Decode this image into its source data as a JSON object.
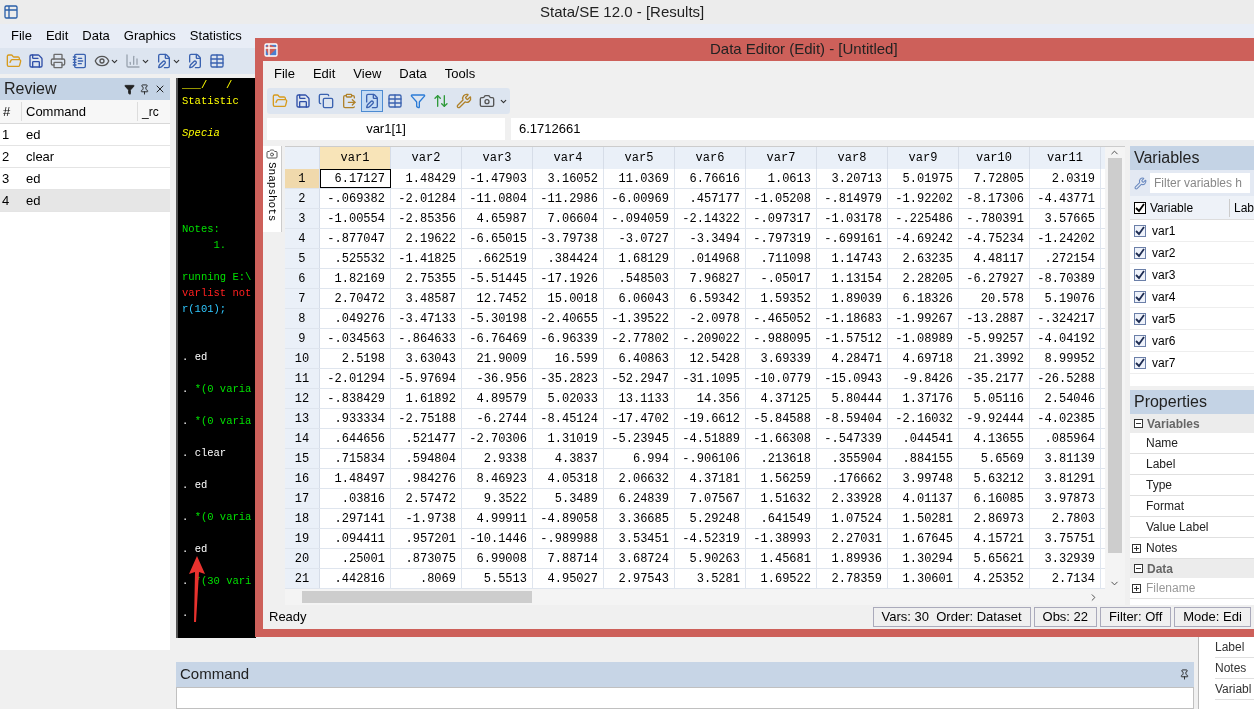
{
  "window": {
    "title": "Stata/SE 12.0 - [Results]"
  },
  "menu": [
    "File",
    "Edit",
    "Data",
    "Graphics",
    "Statistics"
  ],
  "toolbar": [
    {
      "kind": "open"
    },
    {
      "kind": "save"
    },
    {
      "kind": "print"
    },
    {
      "kind": "log"
    },
    {
      "kind": "viewer"
    },
    {
      "kind": "graph"
    },
    {
      "kind": "dofile"
    },
    {
      "kind": "edit"
    },
    {
      "kind": "browse"
    }
  ],
  "review": {
    "title": "Review",
    "columns": [
      "#",
      "Command",
      "_rc"
    ],
    "rows": [
      {
        "num": "1",
        "command": "ed",
        "selected": false
      },
      {
        "num": "2",
        "command": "clear",
        "selected": false
      },
      {
        "num": "3",
        "command": "ed",
        "selected": false
      },
      {
        "num": "4",
        "command": "ed",
        "selected": true
      }
    ]
  },
  "results": [
    {
      "kind": "banner",
      "text": "___/   /"
    },
    {
      "kind": "banner",
      "text": "Statistic"
    },
    {
      "kind": "blank"
    },
    {
      "kind": "banner_italic",
      "text": "Specia"
    },
    {
      "kind": "blank"
    },
    {
      "kind": "blank"
    },
    {
      "kind": "blank"
    },
    {
      "kind": "blank"
    },
    {
      "kind": "blank"
    },
    {
      "kind": "output",
      "text": "Notes:"
    },
    {
      "kind": "output",
      "text": "     1."
    },
    {
      "kind": "blank"
    },
    {
      "kind": "output",
      "text": "running E:\\"
    },
    {
      "kind": "error",
      "text": "varlist not"
    },
    {
      "kind": "rc",
      "text": "r(101);"
    },
    {
      "kind": "blank"
    },
    {
      "kind": "blank"
    },
    {
      "kind": "command",
      "prompt": ".",
      "text": "ed"
    },
    {
      "kind": "blank"
    },
    {
      "kind": "echo",
      "prompt": ".",
      "text": "*(0 varia"
    },
    {
      "kind": "blank"
    },
    {
      "kind": "echo",
      "prompt": ".",
      "text": "*(0 varia"
    },
    {
      "kind": "blank"
    },
    {
      "kind": "command",
      "prompt": ".",
      "text": "clear"
    },
    {
      "kind": "blank"
    },
    {
      "kind": "command",
      "prompt": ".",
      "text": "ed"
    },
    {
      "kind": "blank"
    },
    {
      "kind": "echo",
      "prompt": ".",
      "text": "*(0 varia"
    },
    {
      "kind": "blank"
    },
    {
      "kind": "command",
      "prompt": ".",
      "text": "ed"
    },
    {
      "kind": "blank"
    },
    {
      "kind": "echo",
      "prompt": ".",
      "text": "*(30 vari"
    },
    {
      "kind": "blank"
    },
    {
      "kind": "command",
      "prompt": "."
    }
  ],
  "command_panel": {
    "title": "Command"
  },
  "background_properties": [
    "Label",
    "Notes",
    "Variabl"
  ],
  "data_editor": {
    "title": "Data Editor (Edit) - [Untitled]",
    "menu": [
      "File",
      "Edit",
      "View",
      "Data",
      "Tools"
    ],
    "toolbar": [
      {
        "kind": "open",
        "selected": false
      },
      {
        "kind": "save",
        "selected": false
      },
      {
        "kind": "copy",
        "selected": false
      },
      {
        "kind": "paste",
        "selected": false
      },
      {
        "kind": "edit",
        "selected": true
      },
      {
        "kind": "browse",
        "selected": false
      },
      {
        "kind": "filter",
        "selected": false
      },
      {
        "kind": "varmanager",
        "selected": false
      },
      {
        "kind": "properties",
        "selected": false
      },
      {
        "kind": "snapshot",
        "selected": false
      }
    ],
    "cell_ref": "var1[1]",
    "cell_value": "6.1712661",
    "snapshots_tab": "Snapshots",
    "columns": [
      {
        "name": "var1",
        "selected": true
      },
      {
        "name": "var2",
        "selected": false
      },
      {
        "name": "var3",
        "selected": false
      },
      {
        "name": "var4",
        "selected": false
      },
      {
        "name": "var5",
        "selected": false
      },
      {
        "name": "var6",
        "selected": false
      },
      {
        "name": "var7",
        "selected": false
      },
      {
        "name": "var8",
        "selected": false
      },
      {
        "name": "var9",
        "selected": false
      },
      {
        "name": "var10",
        "selected": false
      },
      {
        "name": "var11",
        "selected": false
      }
    ],
    "rows": [
      {
        "label": "1",
        "selected": true,
        "cells": [
          "6.17127",
          "1.48429",
          "-1.47903",
          "3.16052",
          "11.0369",
          "6.76616",
          "1.0613",
          "3.20713",
          "5.01975",
          "7.72805",
          "2.0319"
        ]
      },
      {
        "label": "2",
        "selected": false,
        "cells": [
          "-.069382",
          "-2.01284",
          "-11.0804",
          "-11.2986",
          "-6.00969",
          ".457177",
          "-1.05208",
          "-.814979",
          "-1.92202",
          "-8.17306",
          "-4.43771"
        ]
      },
      {
        "label": "3",
        "selected": false,
        "cells": [
          "-1.00554",
          "-2.85356",
          "4.65987",
          "7.06604",
          "-.094059",
          "-2.14322",
          "-.097317",
          "-1.03178",
          "-.225486",
          "-.780391",
          "3.57665"
        ]
      },
      {
        "label": "4",
        "selected": false,
        "cells": [
          "-.877047",
          "2.19622",
          "-6.65015",
          "-3.79738",
          "-3.0727",
          "-3.3494",
          "-.797319",
          "-.699161",
          "-4.69242",
          "-4.75234",
          "-1.24202"
        ]
      },
      {
        "label": "5",
        "selected": false,
        "cells": [
          ".525532",
          "-1.41825",
          ".662519",
          ".384424",
          "1.68129",
          ".014968",
          ".711098",
          "1.14743",
          "2.63235",
          "4.48117",
          ".272154"
        ]
      },
      {
        "label": "6",
        "selected": false,
        "cells": [
          "1.82169",
          "2.75355",
          "-5.51445",
          "-17.1926",
          ".548503",
          "7.96827",
          "-.05017",
          "1.13154",
          "2.28205",
          "-6.27927",
          "-8.70389"
        ]
      },
      {
        "label": "7",
        "selected": false,
        "cells": [
          "2.70472",
          "3.48587",
          "12.7452",
          "15.0018",
          "6.06043",
          "6.59342",
          "1.59352",
          "1.89039",
          "6.18326",
          "20.578",
          "5.19076"
        ]
      },
      {
        "label": "8",
        "selected": false,
        "cells": [
          ".049276",
          "-3.47133",
          "-5.30198",
          "-2.40655",
          "-1.39522",
          "-2.0978",
          "-.465052",
          "-1.18683",
          "-1.99267",
          "-13.2887",
          "-.324217"
        ]
      },
      {
        "label": "9",
        "selected": false,
        "cells": [
          "-.034563",
          "-.864633",
          "-6.76469",
          "-6.96339",
          "-2.77802",
          "-.209022",
          "-.988095",
          "-1.57512",
          "-1.08989",
          "-5.99257",
          "-4.04192"
        ]
      },
      {
        "label": "10",
        "selected": false,
        "cells": [
          "2.5198",
          "3.63043",
          "21.9009",
          "16.599",
          "6.40863",
          "12.5428",
          "3.69339",
          "4.28471",
          "4.69718",
          "21.3992",
          "8.99952"
        ]
      },
      {
        "label": "11",
        "selected": false,
        "cells": [
          "-2.01294",
          "-5.97694",
          "-36.956",
          "-35.2823",
          "-52.2947",
          "-31.1095",
          "-10.0779",
          "-15.0943",
          "-9.8426",
          "-35.2177",
          "-26.5288"
        ]
      },
      {
        "label": "12",
        "selected": false,
        "cells": [
          "-.838429",
          "1.61892",
          "4.89579",
          "5.02033",
          "13.1133",
          "14.356",
          "4.37125",
          "5.80444",
          "1.37176",
          "5.05116",
          "2.54046"
        ]
      },
      {
        "label": "13",
        "selected": false,
        "cells": [
          ".933334",
          "-2.75188",
          "-6.2744",
          "-8.45124",
          "-17.4702",
          "-19.6612",
          "-5.84588",
          "-8.59404",
          "-2.16032",
          "-9.92444",
          "-4.02385"
        ]
      },
      {
        "label": "14",
        "selected": false,
        "cells": [
          ".644656",
          ".521477",
          "-2.70306",
          "1.31019",
          "-5.23945",
          "-4.51889",
          "-1.66308",
          "-.547339",
          ".044541",
          "4.13655",
          ".085964"
        ]
      },
      {
        "label": "15",
        "selected": false,
        "cells": [
          ".715834",
          ".594804",
          "2.9338",
          "4.3837",
          "6.994",
          "-.906106",
          ".213618",
          ".355904",
          ".884155",
          "5.6569",
          "3.81139"
        ]
      },
      {
        "label": "16",
        "selected": false,
        "cells": [
          "1.48497",
          ".984276",
          "8.46923",
          "4.05318",
          "2.06632",
          "4.37181",
          "1.56259",
          ".176662",
          "3.99748",
          "5.63212",
          "3.81291"
        ]
      },
      {
        "label": "17",
        "selected": false,
        "cells": [
          ".03816",
          "2.57472",
          "9.3522",
          "5.3489",
          "6.24839",
          "7.07567",
          "1.51632",
          "2.33928",
          "4.01137",
          "6.16085",
          "3.97873"
        ]
      },
      {
        "label": "18",
        "selected": false,
        "cells": [
          ".297141",
          "-1.9738",
          "4.99911",
          "-4.89058",
          "3.36685",
          "5.29248",
          ".641549",
          "1.07524",
          "1.50281",
          "2.86973",
          "2.7803"
        ]
      },
      {
        "label": "19",
        "selected": false,
        "cells": [
          ".094411",
          ".957201",
          "-10.1446",
          "-.989988",
          "3.53451",
          "-4.52319",
          "-1.38993",
          "2.27031",
          "1.67645",
          "4.15721",
          "3.75751"
        ]
      },
      {
        "label": "20",
        "selected": false,
        "cells": [
          ".25001",
          ".873075",
          "6.99008",
          "7.88714",
          "3.68724",
          "5.90263",
          "1.45681",
          "1.89936",
          "1.30294",
          "5.65621",
          "3.32939"
        ]
      },
      {
        "label": "21",
        "selected": false,
        "cells": [
          ".442816",
          ".8069",
          "5.5513",
          "4.95027",
          "2.97543",
          "3.5281",
          "1.69522",
          "2.78359",
          "1.30601",
          "4.25352",
          "2.7134"
        ]
      }
    ],
    "variables": {
      "title": "Variables",
      "filter": {
        "placeholder": "Filter variables h"
      },
      "header_checked": true,
      "columns": [
        "Variable",
        "Lab"
      ],
      "items": [
        {
          "name": "var1",
          "checked": true
        },
        {
          "name": "var2",
          "checked": true
        },
        {
          "name": "var3",
          "checked": true
        },
        {
          "name": "var4",
          "checked": true
        },
        {
          "name": "var5",
          "checked": true
        },
        {
          "name": "var6",
          "checked": true
        },
        {
          "name": "var7",
          "checked": true
        }
      ]
    },
    "properties": {
      "title": "Properties",
      "groups": [
        {
          "label": "Variables",
          "expanded": true,
          "items": [
            {
              "label": "Name"
            },
            {
              "label": "Label"
            },
            {
              "label": "Type"
            },
            {
              "label": "Format"
            },
            {
              "label": "Value Label"
            },
            {
              "label": "Notes",
              "expanded": false
            }
          ]
        },
        {
          "label": "Data",
          "expanded": true,
          "items": [
            {
              "label": "Filename",
              "expanded": false,
              "disabled": true
            }
          ]
        }
      ]
    },
    "status_bar": {
      "message": "Ready",
      "segments": [
        "Vars: 30  Order: Dataset",
        "Obs: 22",
        "Filter: Off",
        "Mode: Edi"
      ]
    }
  }
}
